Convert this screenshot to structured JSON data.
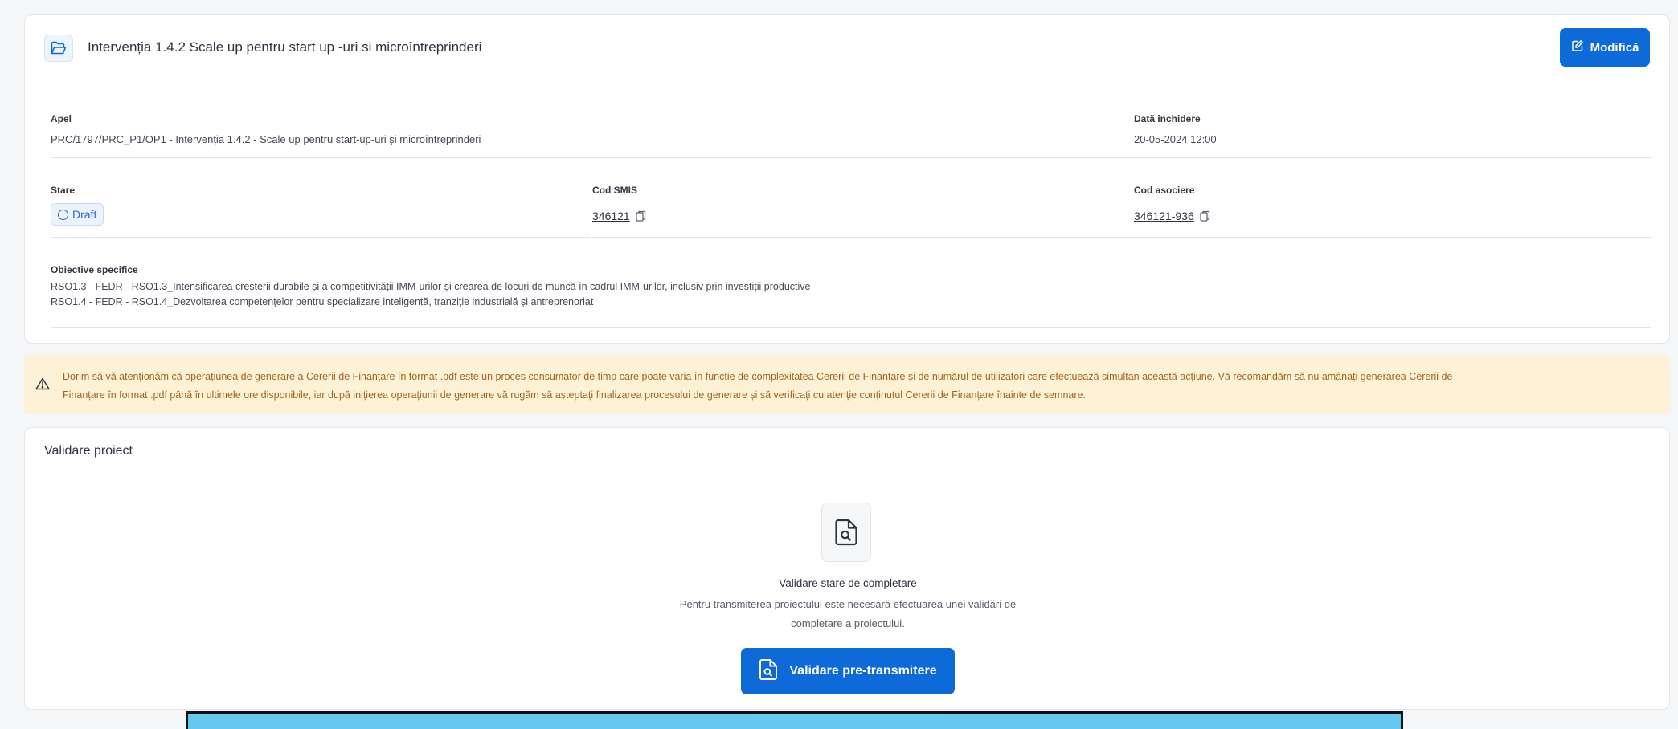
{
  "header": {
    "title": "Intervenția 1.4.2 Scale up pentru start up -uri si microîntreprinderi",
    "modify_label": "Modifică"
  },
  "fields": {
    "apel_label": "Apel",
    "apel_value": "PRC/1797/PRC_P1/OP1 - Intervenția 1.4.2 - Scale up pentru start-up-uri și microîntreprinderi",
    "data_inchidere_label": "Dată închidere",
    "data_inchidere_value": "20-05-2024 12:00",
    "stare_label": "Stare",
    "stare_value": "Draft",
    "cod_smis_label": "Cod SMIS",
    "cod_smis_value": "346121",
    "cod_asociere_label": "Cod asociere",
    "cod_asociere_value": "346121-936",
    "obiective_label": "Obiective specifice",
    "obiective": [
      "RSO1.3 - FEDR - RSO1.3_Intensificarea creșterii durabile și a competitivității IMM-urilor și crearea de locuri de muncă în cadrul IMM-urilor, inclusiv prin investiții productive",
      "RSO1.4 - FEDR - RSO1.4_Dezvoltarea competențelor pentru specializare inteligentă, tranziție industrială și antreprenoriat"
    ]
  },
  "warning": {
    "line1": "Dorim să vă atenționăm că operațiunea de generare a Cererii de Finanțare în format .pdf este un proces consumator de timp care poate varia în funcție de complexitatea Cererii de Finanțare și de numărul de utilizatori care efectuează simultan această acțiune. Vă recomandăm să nu amânați generarea Cererii de",
    "line2": "Finanțare în format .pdf până în ultimele ore disponibile, iar după inițierea operațiunii de generare vă rugăm să așteptați finalizarea procesului de generare și să verificați cu atenție conținutul Cererii de Finanțare înainte de semnare."
  },
  "validation": {
    "section_title": "Validare proiect",
    "title": "Validare stare de completare",
    "description_line1": "Pentru transmiterea proiectului este necesară efectuarea unei validări de",
    "description_line2": "completare a proiectului.",
    "button_label": "Validare pre-transmitere"
  },
  "icons": {
    "header_icon": "folder-open-icon",
    "modify_icon": "edit-icon",
    "copy_icon": "copy-icon",
    "warning_icon": "warning-triangle-icon",
    "document_search_icon": "document-search-icon"
  },
  "colors": {
    "primary": "#0d6ad8",
    "warning_bg": "#fdf2d6",
    "warning_text": "#a5631f",
    "draft_badge": "#2e67c7",
    "highlight_bar": "#64c8ef"
  }
}
